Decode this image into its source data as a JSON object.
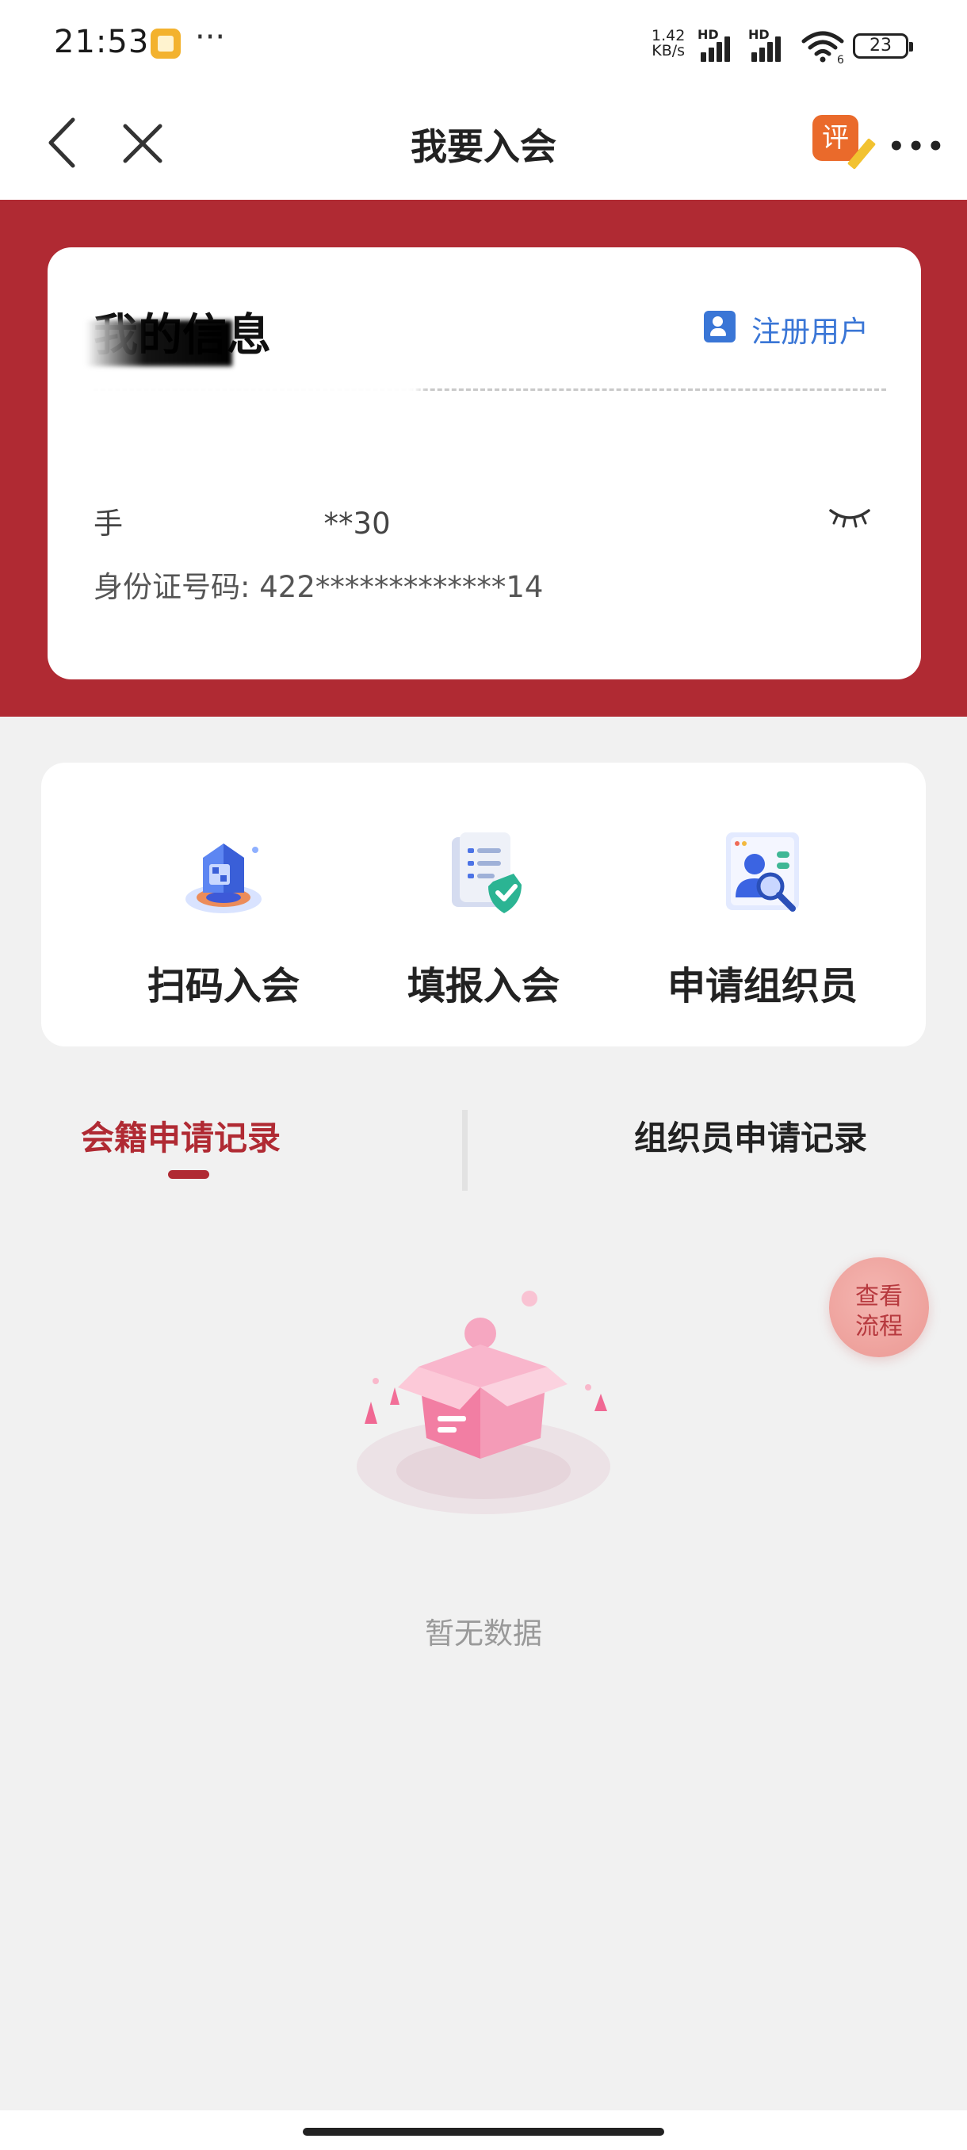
{
  "status_bar": {
    "time": "21:53",
    "more_glyph": "···",
    "net_speed_value": "1.42",
    "net_speed_unit": "KB/s",
    "hd_label": "HD",
    "wifi_badge": "6",
    "battery_level": "23"
  },
  "nav": {
    "title": "我要入会",
    "review_badge": "评",
    "more_glyph": "•••"
  },
  "info_card": {
    "title": "我的信息",
    "register_label": "注册用户",
    "phone_prefix": "手",
    "phone_suffix": "**30",
    "id_label": "身份证号码:",
    "id_value": "422*************14"
  },
  "actions": [
    {
      "label": "扫码入会",
      "icon": "qr-scan-icon"
    },
    {
      "label": "填报入会",
      "icon": "form-fill-icon"
    },
    {
      "label": "申请组织员",
      "icon": "organizer-apply-icon"
    }
  ],
  "tabs": {
    "member_records": "会籍申请记录",
    "organizer_records": "组织员申请记录",
    "active": "member_records"
  },
  "float_button": {
    "line1": "查看",
    "line2": "流程"
  },
  "empty_state": {
    "text": "暂无数据"
  },
  "colors": {
    "brand_red": "#b02a33",
    "link_blue": "#3a76d6",
    "background": "#f1f1f1",
    "float_pink": "#eea19c"
  }
}
